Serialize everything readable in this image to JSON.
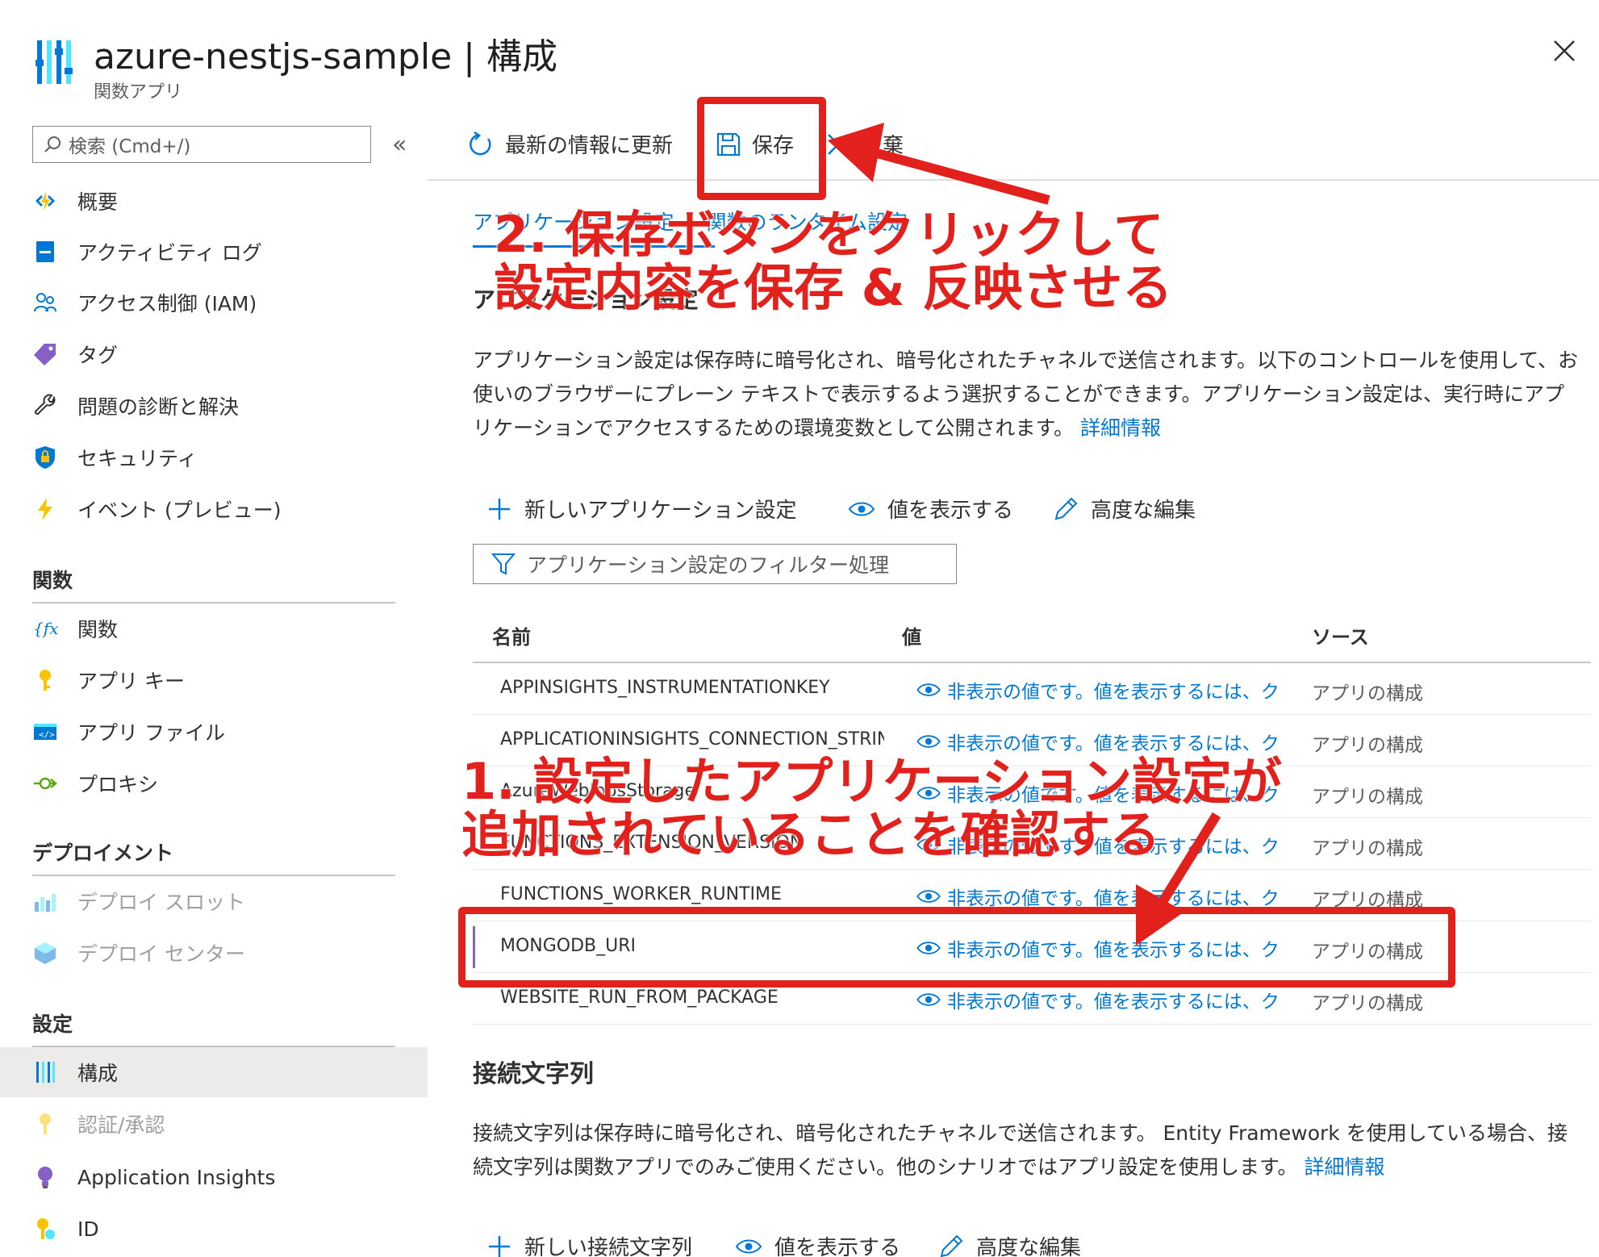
{
  "header": {
    "title": "azure-nestjs-sample | 構成",
    "subtitle": "関数アプリ",
    "close_icon": "close-icon"
  },
  "sidebar": {
    "search_placeholder": "検索 (Cmd+/)",
    "collapse_label": "«",
    "items": [
      {
        "label": "概要",
        "icon": "function-app-icon"
      },
      {
        "label": "アクティビティ ログ",
        "icon": "activity-log-icon"
      },
      {
        "label": "アクセス制御 (IAM)",
        "icon": "people-icon"
      },
      {
        "label": "タグ",
        "icon": "tag-icon"
      },
      {
        "label": "問題の診断と解決",
        "icon": "wrench-icon"
      },
      {
        "label": "セキュリティ",
        "icon": "shield-icon"
      },
      {
        "label": "イベント (プレビュー)",
        "icon": "lightning-icon"
      }
    ],
    "section_functions": "関数",
    "functions_items": [
      {
        "label": "関数",
        "icon": "function-icon"
      },
      {
        "label": "アプリ キー",
        "icon": "key-icon"
      },
      {
        "label": "アプリ ファイル",
        "icon": "code-file-icon"
      },
      {
        "label": "プロキシ",
        "icon": "proxy-icon"
      }
    ],
    "section_deploy": "デプロイメント",
    "deploy_items": [
      {
        "label": "デプロイ スロット",
        "icon": "slots-icon"
      },
      {
        "label": "デプロイ センター",
        "icon": "cube-icon"
      }
    ],
    "section_settings": "設定",
    "settings_items": [
      {
        "label": "構成",
        "icon": "config-icon"
      },
      {
        "label": "認証/承認",
        "icon": "key-icon"
      },
      {
        "label": "Application Insights",
        "icon": "lightbulb-icon"
      },
      {
        "label": "ID",
        "icon": "identity-key-icon"
      }
    ]
  },
  "toolbar": {
    "refresh": "最新の情報に更新",
    "save": "保存",
    "discard": "破棄"
  },
  "content": {
    "tabs": [
      "アプリケーション設定",
      "関数のランタイム設定"
    ],
    "section_heading": "アプリケーション設定",
    "description": "アプリケーション設定は保存時に暗号化され、暗号化されたチャネルで送信されます。以下のコントロールを使用して、お使いのブラウザーにプレーン テキストで表示するよう選択することができます。アプリケーション設定は、実行時にアプリケーションでアクセスするための環境変数として公開されます。",
    "details_link": "詳細情報",
    "commands": {
      "new_setting": "新しいアプリケーション設定",
      "show_values": "値を表示する",
      "advanced_edit": "高度な編集"
    },
    "filter_placeholder": "アプリケーション設定のフィルター処理",
    "table": {
      "headers": [
        "名前",
        "値",
        "ソース"
      ],
      "rows": [
        {
          "name": "APPINSIGHTS_INSTRUMENTATIONKEY",
          "value": "非表示の値です。値を表示するには、ク",
          "source": "アプリの構成"
        },
        {
          "name": "APPLICATIONINSIGHTS_CONNECTION_STRIN",
          "value": "非表示の値です。値を表示するには、ク",
          "source": "アプリの構成"
        },
        {
          "name": "AzureWebJobsStorage",
          "value": "非表示の値です。値を表示するには、ク",
          "source": "アプリの構成"
        },
        {
          "name": "FUNCTIONS_EXTENSION_VERSION",
          "value": "非表示の値です。値を表示するには、ク",
          "source": "アプリの構成"
        },
        {
          "name": "FUNCTIONS_WORKER_RUNTIME",
          "value": "非表示の値です。値を表示するには、ク",
          "source": "アプリの構成"
        },
        {
          "name": "MONGODB_URI",
          "value": "非表示の値です。値を表示するには、ク",
          "source": "アプリの構成"
        },
        {
          "name": "WEBSITE_RUN_FROM_PACKAGE",
          "value": "非表示の値です。値を表示するには、ク",
          "source": "アプリの構成"
        }
      ]
    },
    "conn_heading": "接続文字列",
    "conn_description": "接続文字列は保存時に暗号化され、暗号化されたチャネルで送信されます。 Entity Framework を使用している場合、接続文字列は関数アプリでのみご使用ください。他のシナリオではアプリ設定を使用します。",
    "conn_details_link": "詳細情報",
    "conn_commands": {
      "new_conn": "新しい接続文字列",
      "show_values": "値を表示する",
      "advanced_edit": "高度な編集"
    }
  },
  "annotations": {
    "save_note_line1": "2. 保存ボタンをクリックして",
    "save_note_line2": "設定内容を保存 & 反映させる",
    "confirm_note_line1": "1. 設定したアプリケーション設定が",
    "confirm_note_line2": "追加されていることを確認する",
    "color": "#e2201c"
  },
  "colors": {
    "accent": "#0078d4",
    "selected_row_bar": "#8764b8",
    "active_nav_bg": "#edebe9"
  }
}
